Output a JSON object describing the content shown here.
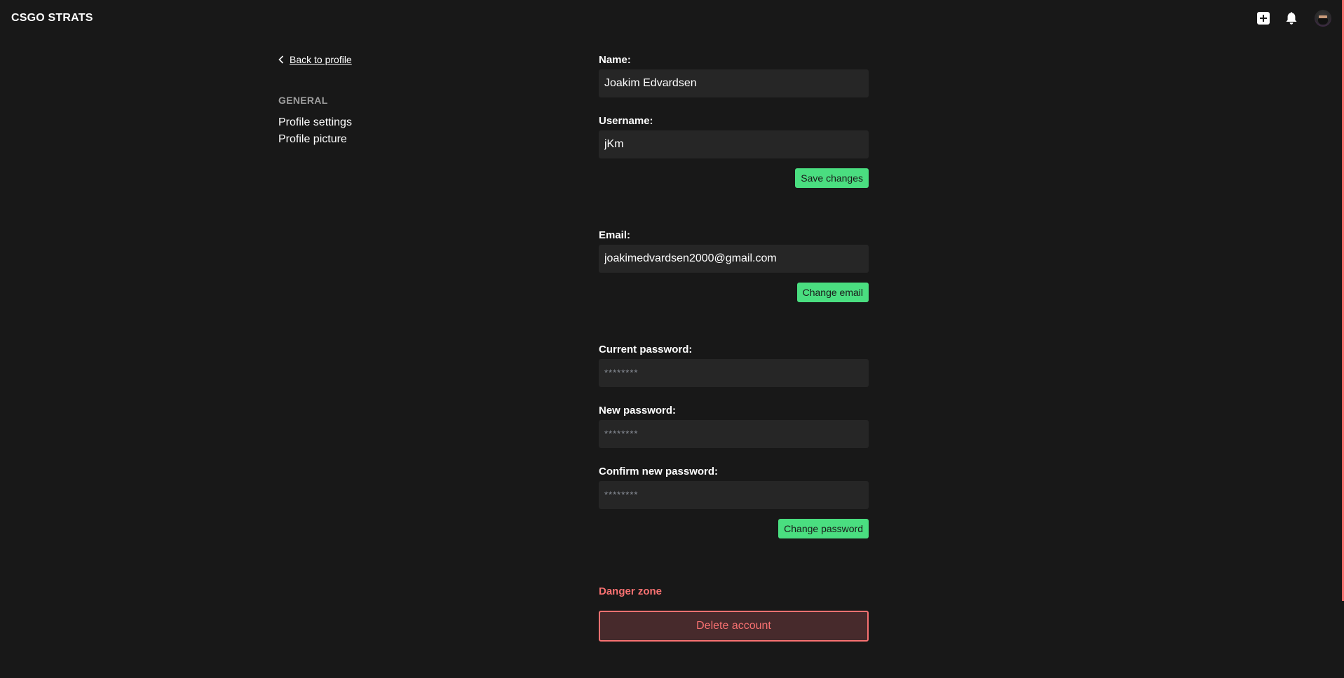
{
  "app": {
    "brand": "CSGO STRATS"
  },
  "header": {
    "icons": {
      "add": "plus-square-icon",
      "notifications": "bell-icon",
      "avatar": "avatar"
    }
  },
  "sidebar": {
    "back_label": "Back to profile",
    "section_title": "GENERAL",
    "items": [
      {
        "label": "Profile settings"
      },
      {
        "label": "Profile picture"
      }
    ]
  },
  "profile": {
    "name_label": "Name:",
    "name_value": "Joakim Edvardsen",
    "username_label": "Username:",
    "username_value": "jKm",
    "save_label": "Save changes"
  },
  "email": {
    "label": "Email:",
    "value": "joakimedvardsen2000@gmail.com",
    "button_label": "Change email"
  },
  "password": {
    "current_label": "Current password:",
    "current_placeholder": "********",
    "new_label": "New password:",
    "new_placeholder": "********",
    "confirm_label": "Confirm new password:",
    "confirm_placeholder": "********",
    "button_label": "Change password"
  },
  "danger": {
    "title": "Danger zone",
    "delete_label": "Delete account"
  },
  "colors": {
    "background": "#181818",
    "input_bg": "#262626",
    "accent_green": "#4ade80",
    "danger_red": "#f87171",
    "danger_bg": "#472a2c"
  }
}
